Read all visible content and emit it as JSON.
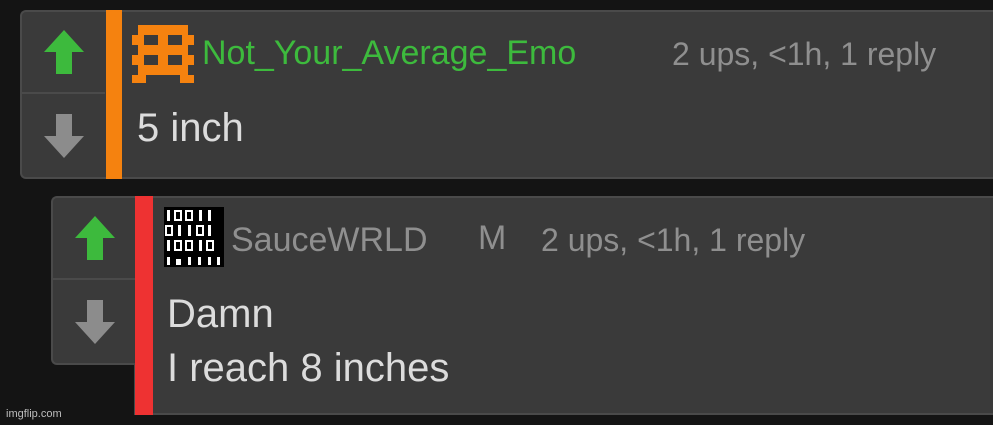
{
  "comments": [
    {
      "username": "Not_Your_Average_Emo",
      "username_color": "#3dba3d",
      "meta": "2 ups, <1h, 1 reply",
      "body": [
        "5 inch"
      ],
      "bar_color": "#f5820f",
      "avatar_icon": "orange-pixel-avatar-icon"
    },
    {
      "username": "SauceWRLD",
      "username_color": "#8f8f8f",
      "badge": "M",
      "meta": "2 ups, <1h, 1 reply",
      "body": [
        "Damn",
        "I reach 8 inches"
      ],
      "bar_color": "#ee3232",
      "avatar_icon": "binary-avatar-icon"
    }
  ],
  "watermark": "imgflip.com",
  "colors": {
    "upvote": "#3dba3d",
    "downvote": "#8c8c8c",
    "background": "#141414",
    "panel": "#3a3a3a"
  }
}
